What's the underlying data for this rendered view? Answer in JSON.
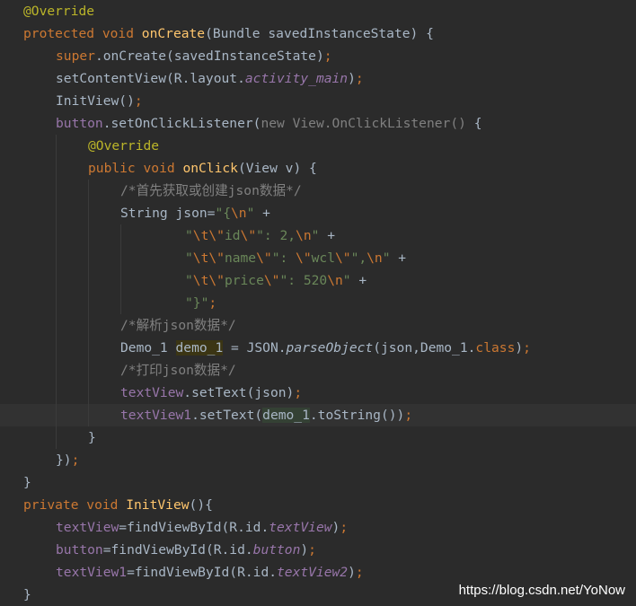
{
  "editor": {
    "lines": [
      {
        "segments": [
          {
            "t": "@Override",
            "c": "ann"
          }
        ]
      },
      {
        "segments": [
          {
            "t": "protected void ",
            "c": "kw"
          },
          {
            "t": "onCreate",
            "c": "fn"
          },
          {
            "t": "(Bundle savedInstanceState) {",
            "c": ""
          }
        ]
      },
      {
        "segments": [
          {
            "t": "super",
            "c": "kw"
          },
          {
            "t": ".onCreate(savedInstanceState)",
            "c": ""
          },
          {
            "t": ";",
            "c": "kw"
          }
        ]
      },
      {
        "segments": [
          {
            "t": "setContentView(R.layout.",
            "c": ""
          },
          {
            "t": "activity_main",
            "c": "it-fld"
          },
          {
            "t": ")",
            "c": ""
          },
          {
            "t": ";",
            "c": "kw"
          }
        ]
      },
      {
        "segments": [
          {
            "t": "InitView()",
            "c": ""
          },
          {
            "t": ";",
            "c": "kw"
          }
        ]
      },
      {
        "segments": [
          {
            "t": "button",
            "c": "fld"
          },
          {
            "t": ".setOnClickListener(",
            "c": ""
          },
          {
            "t": "new View.OnClickListener() ",
            "c": "param"
          },
          {
            "t": "{",
            "c": ""
          }
        ]
      },
      {
        "segments": [
          {
            "t": "@Override",
            "c": "ann"
          }
        ]
      },
      {
        "segments": [
          {
            "t": "public void ",
            "c": "kw"
          },
          {
            "t": "onClick",
            "c": "fn"
          },
          {
            "t": "(View v) {",
            "c": ""
          }
        ]
      },
      {
        "segments": [
          {
            "t": "/*首先获取或创建json数据*/",
            "c": "cm"
          }
        ]
      },
      {
        "segments": [
          {
            "t": "String json=",
            "c": ""
          },
          {
            "t": "\"{",
            "c": "str"
          },
          {
            "t": "\\n",
            "c": "esc"
          },
          {
            "t": "\"",
            "c": "str"
          },
          {
            "t": " +",
            "c": ""
          }
        ]
      },
      {
        "segments": [
          {
            "t": "\"",
            "c": "str"
          },
          {
            "t": "\\t\\\"",
            "c": "esc"
          },
          {
            "t": "id",
            "c": "str"
          },
          {
            "t": "\\\"",
            "c": "esc"
          },
          {
            "t": "\": 2,",
            "c": "str"
          },
          {
            "t": "\\n",
            "c": "esc"
          },
          {
            "t": "\"",
            "c": "str"
          },
          {
            "t": " +",
            "c": ""
          }
        ]
      },
      {
        "segments": [
          {
            "t": "\"",
            "c": "str"
          },
          {
            "t": "\\t\\\"",
            "c": "esc"
          },
          {
            "t": "name",
            "c": "str"
          },
          {
            "t": "\\\"",
            "c": "esc"
          },
          {
            "t": "\": ",
            "c": "str"
          },
          {
            "t": "\\\"",
            "c": "esc"
          },
          {
            "t": "wcl",
            "c": "str"
          },
          {
            "t": "\\\"",
            "c": "esc"
          },
          {
            "t": "\",",
            "c": "str"
          },
          {
            "t": "\\n",
            "c": "esc"
          },
          {
            "t": "\"",
            "c": "str"
          },
          {
            "t": " +",
            "c": ""
          }
        ]
      },
      {
        "segments": [
          {
            "t": "\"",
            "c": "str"
          },
          {
            "t": "\\t\\\"",
            "c": "esc"
          },
          {
            "t": "price",
            "c": "str"
          },
          {
            "t": "\\\"",
            "c": "esc"
          },
          {
            "t": "\": 520",
            "c": "str"
          },
          {
            "t": "\\n",
            "c": "esc"
          },
          {
            "t": "\"",
            "c": "str"
          },
          {
            "t": " +",
            "c": ""
          }
        ]
      },
      {
        "segments": [
          {
            "t": "\"}\"",
            "c": "str"
          },
          {
            "t": ";",
            "c": "kw"
          }
        ]
      },
      {
        "segments": [
          {
            "t": "/*解析json数据*/",
            "c": "cm"
          }
        ]
      },
      {
        "segments": [
          {
            "t": "Demo_1 ",
            "c": ""
          },
          {
            "t": "demo_1",
            "c": "hl2"
          },
          {
            "t": " = JSON.",
            "c": ""
          },
          {
            "t": "parseObject",
            "c": "static-it"
          },
          {
            "t": "(json,Demo_1.",
            "c": ""
          },
          {
            "t": "class",
            "c": "kw"
          },
          {
            "t": ")",
            "c": ""
          },
          {
            "t": ";",
            "c": "kw"
          }
        ]
      },
      {
        "segments": [
          {
            "t": "/*打印json数据*/",
            "c": "cm"
          }
        ]
      },
      {
        "segments": [
          {
            "t": "textView",
            "c": "fld"
          },
          {
            "t": ".setText(json)",
            "c": ""
          },
          {
            "t": ";",
            "c": "kw"
          }
        ]
      },
      {
        "segments": [
          {
            "t": "textView1",
            "c": "fld"
          },
          {
            "t": ".setText(",
            "c": ""
          },
          {
            "t": "demo_1",
            "c": "hl"
          },
          {
            "t": ".toString())",
            "c": ""
          },
          {
            "t": ";",
            "c": "kw"
          }
        ]
      },
      {
        "segments": [
          {
            "t": "}",
            "c": ""
          }
        ]
      },
      {
        "segments": [
          {
            "t": "})",
            "c": ""
          },
          {
            "t": ";",
            "c": "kw"
          }
        ]
      },
      {
        "segments": [
          {
            "t": "}",
            "c": ""
          }
        ]
      },
      {
        "segments": [
          {
            "t": "private void ",
            "c": "kw"
          },
          {
            "t": "InitView",
            "c": "fn"
          },
          {
            "t": "(){",
            "c": ""
          }
        ]
      },
      {
        "segments": [
          {
            "t": "textView",
            "c": "fld"
          },
          {
            "t": "=findViewById(R.id.",
            "c": ""
          },
          {
            "t": "textView",
            "c": "it-fld"
          },
          {
            "t": ")",
            "c": ""
          },
          {
            "t": ";",
            "c": "kw"
          }
        ]
      },
      {
        "segments": [
          {
            "t": "button",
            "c": "fld"
          },
          {
            "t": "=findViewById(R.id.",
            "c": ""
          },
          {
            "t": "button",
            "c": "it-fld"
          },
          {
            "t": ")",
            "c": ""
          },
          {
            "t": ";",
            "c": "kw"
          }
        ]
      },
      {
        "segments": [
          {
            "t": "textView1",
            "c": "fld"
          },
          {
            "t": "=findViewById(R.id.",
            "c": ""
          },
          {
            "t": "textView2",
            "c": "it-fld"
          },
          {
            "t": ")",
            "c": ""
          },
          {
            "t": ";",
            "c": "kw"
          }
        ]
      },
      {
        "segments": [
          {
            "t": "}",
            "c": ""
          }
        ]
      }
    ]
  },
  "watermark": "https://blog.csdn.net/YoNow",
  "colors": {
    "background": "#2b2b2b",
    "current_line": "#323232",
    "text": "#a9b7c6",
    "keyword": "#cc7832",
    "annotation": "#bbb529",
    "function": "#ffc66d",
    "string": "#6a8759",
    "number": "#6897bb",
    "comment": "#808080",
    "field": "#9876aa"
  }
}
